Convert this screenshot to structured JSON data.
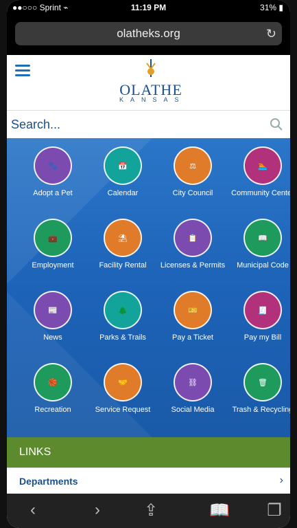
{
  "status": {
    "left": "●●○○○ Sprint",
    "wifi": "wifi-icon",
    "time": "11:19 PM",
    "battery": "31%"
  },
  "browser": {
    "url": "olatheks.org"
  },
  "header": {
    "logo_main": "OLATHE",
    "logo_sub": "KANSAS"
  },
  "search": {
    "label": "Search..."
  },
  "tiles": [
    {
      "label": "Adopt a Pet",
      "icon": "paw-icon",
      "color": "#7b4bb0"
    },
    {
      "label": "Calendar",
      "icon": "calendar-icon",
      "color": "#12a39a"
    },
    {
      "label": "City Council",
      "icon": "gavel-icon",
      "color": "#e07b2a"
    },
    {
      "label": "Community Center",
      "icon": "pool-icon",
      "color": "#b1327b"
    },
    {
      "label": "Employment",
      "icon": "briefcase-icon",
      "color": "#1f9a5d"
    },
    {
      "label": "Facility Rental",
      "icon": "picnic-table-icon",
      "color": "#e07b2a"
    },
    {
      "label": "Licenses & Permits",
      "icon": "clipboard-icon",
      "color": "#7b4bb0"
    },
    {
      "label": "Municipal Code",
      "icon": "book-icon",
      "color": "#1f9a5d"
    },
    {
      "label": "News",
      "icon": "newspaper-icon",
      "color": "#7b4bb0"
    },
    {
      "label": "Parks & Trails",
      "icon": "trail-icon",
      "color": "#12a39a"
    },
    {
      "label": "Pay a Ticket",
      "icon": "ticket-icon",
      "color": "#e07b2a"
    },
    {
      "label": "Pay my Bill",
      "icon": "bill-icon",
      "color": "#b1327b"
    },
    {
      "label": "Recreation",
      "icon": "basketball-icon",
      "color": "#1f9a5d"
    },
    {
      "label": "Service Request",
      "icon": "hands-icon",
      "color": "#e07b2a"
    },
    {
      "label": "Social Media",
      "icon": "share-icon",
      "color": "#7b4bb0"
    },
    {
      "label": "Trash & Recycling",
      "icon": "trash-cart-icon",
      "color": "#1f9a5d"
    }
  ],
  "links": {
    "title": "LINKS",
    "first": "Departments"
  }
}
